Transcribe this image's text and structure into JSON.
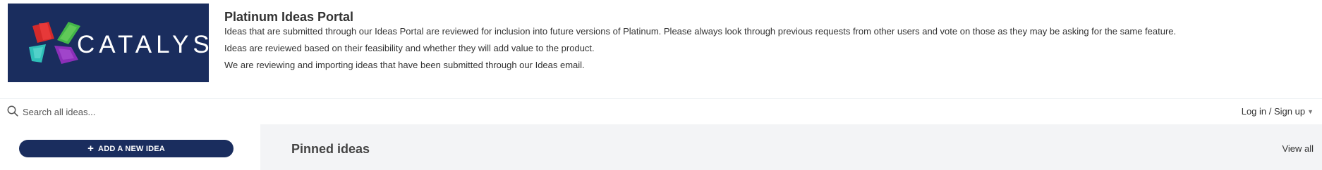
{
  "header": {
    "logo_text": "CATALYST",
    "brand_color": "#1a2d5e",
    "title": "Platinum Ideas Portal",
    "description": [
      "Ideas that are submitted through our Ideas Portal are reviewed for inclusion into future versions of Platinum. Please always look through previous requests from other users and vote on those as they may be asking for the same feature.",
      "Ideas are reviewed based on their feasibility and whether they will add value to the product.",
      "We are reviewing and importing ideas that have been submitted through our Ideas email."
    ]
  },
  "search": {
    "icon": "search-icon",
    "placeholder": "Search all ideas..."
  },
  "account": {
    "login_label": "Log in / Sign up",
    "icon": "chevron-down-icon"
  },
  "sidebar": {
    "add_idea_label": "ADD A NEW IDEA",
    "add_icon": "plus-icon"
  },
  "main": {
    "pinned_title": "Pinned ideas",
    "view_all_label": "View all"
  }
}
